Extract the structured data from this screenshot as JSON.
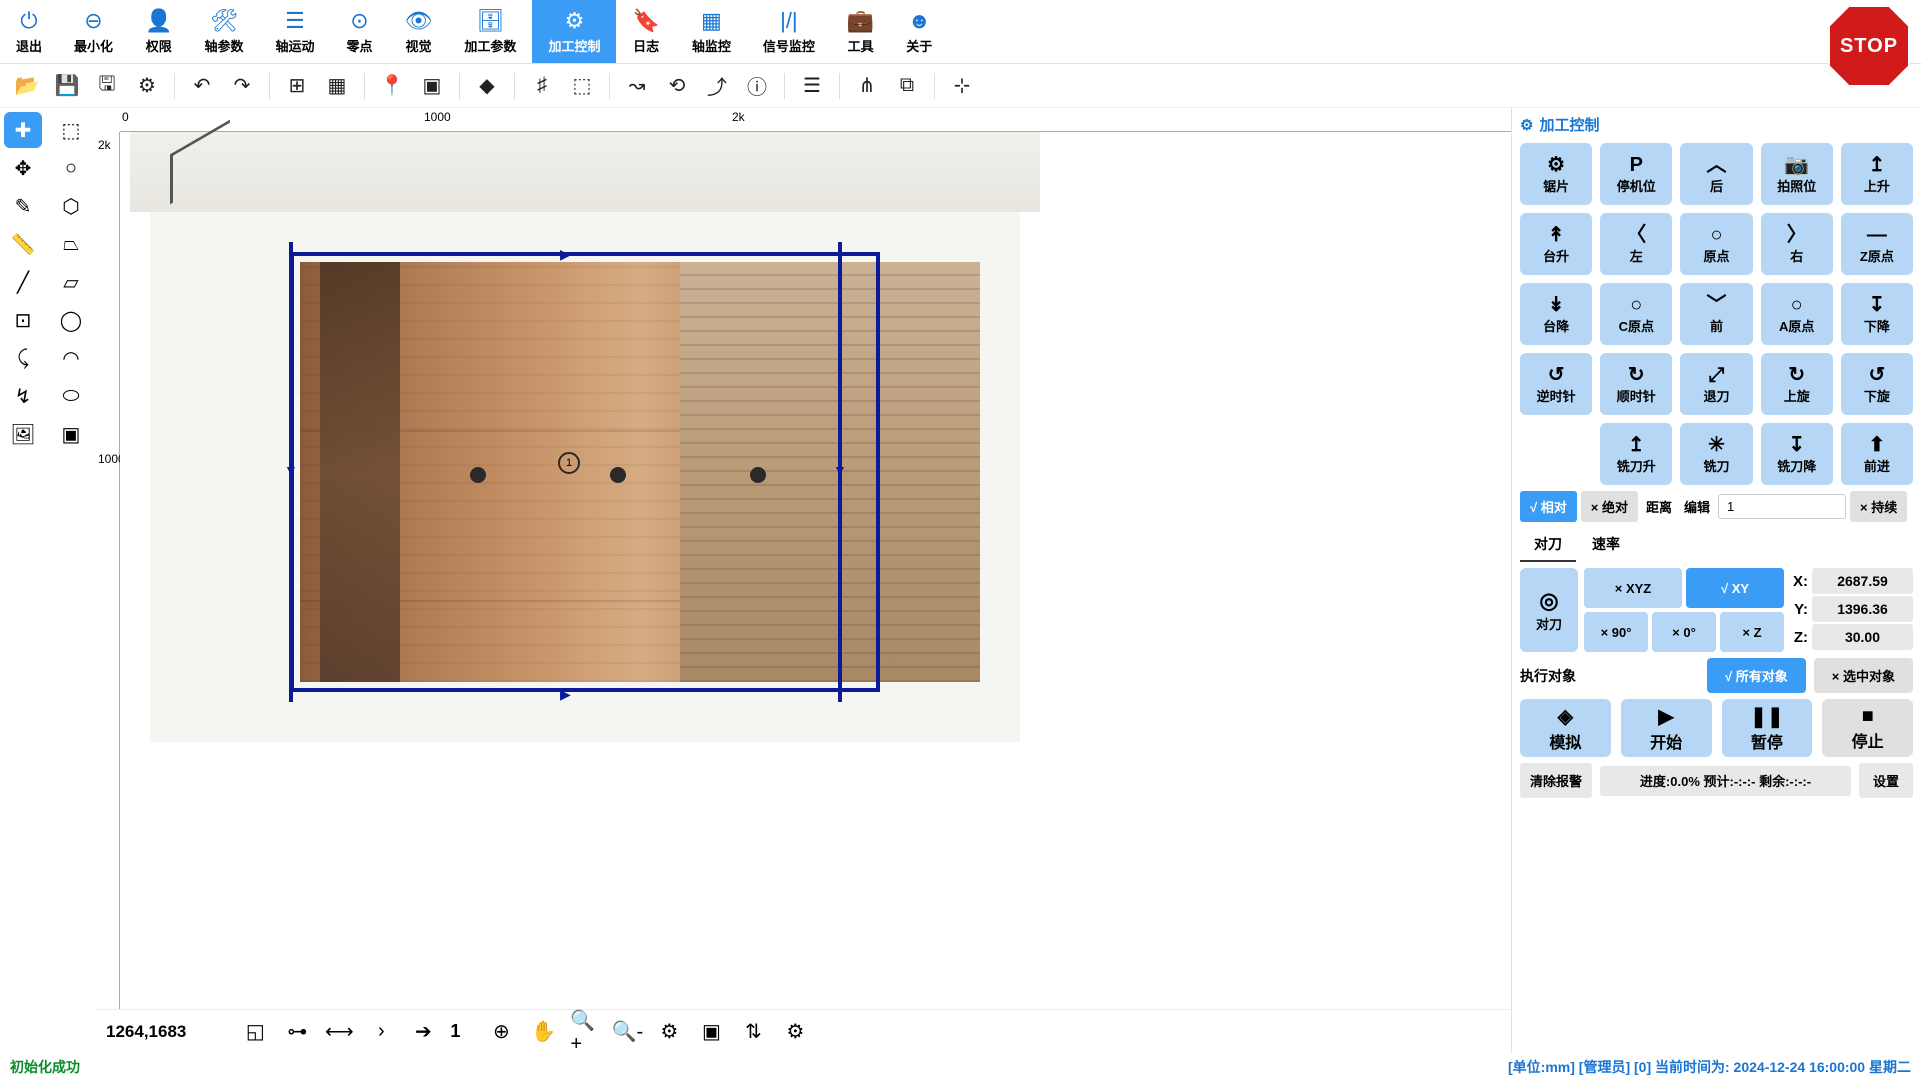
{
  "menu": {
    "items": [
      {
        "icon": "⏻",
        "label": "退出"
      },
      {
        "icon": "⊖",
        "label": "最小化"
      },
      {
        "icon": "👤",
        "label": "权限"
      },
      {
        "icon": "🛠",
        "label": "轴参数"
      },
      {
        "icon": "☰",
        "label": "轴运动"
      },
      {
        "icon": "⊙",
        "label": "零点"
      },
      {
        "icon": "👁",
        "label": "视觉"
      },
      {
        "icon": "🗄",
        "label": "加工参数"
      },
      {
        "icon": "⚙",
        "label": "加工控制",
        "active": true
      },
      {
        "icon": "🔖",
        "label": "日志"
      },
      {
        "icon": "▦",
        "label": "轴监控"
      },
      {
        "icon": "|/|",
        "label": "信号监控"
      },
      {
        "icon": "💼",
        "label": "工具"
      },
      {
        "icon": "☻",
        "label": "关于"
      }
    ]
  },
  "toolbar_icons": [
    "folder",
    "save",
    "save-device",
    "gear",
    "sep",
    "undo",
    "redo",
    "sep",
    "snap",
    "grid",
    "sep",
    "pin",
    "frame",
    "sep",
    "shape",
    "sep",
    "hash",
    "dashsq",
    "sep",
    "path1",
    "path2",
    "path3",
    "info",
    "sep",
    "list",
    "sep",
    "route",
    "layers",
    "sep",
    "align"
  ],
  "left_tools": [
    "✚",
    "⬚",
    "✥",
    "○",
    "✎",
    "⬡",
    "📏",
    "⏢",
    "╱",
    "▱",
    "⊡",
    "◯",
    "⤹",
    "◠",
    "↯",
    "⬭",
    "🖼",
    "▣"
  ],
  "ruler": {
    "h": [
      {
        "pos": "2px",
        "label": "0"
      },
      {
        "pos": "304px",
        "label": "1000"
      },
      {
        "pos": "612px",
        "label": "2k"
      }
    ],
    "v": [
      {
        "pos": "6px",
        "label": "2k"
      },
      {
        "pos": "320px",
        "label": "1000"
      }
    ]
  },
  "right": {
    "title": "加工控制",
    "grid": [
      [
        {
          "icon": "⚙",
          "label": "锯片"
        },
        {
          "icon": "P",
          "label": "停机位"
        },
        {
          "icon": "︿",
          "label": "后"
        },
        {
          "icon": "📷",
          "label": "拍照位"
        },
        {
          "icon": "↥",
          "label": "上升"
        }
      ],
      [
        {
          "icon": "↟",
          "label": "台升"
        },
        {
          "icon": "〈",
          "label": "左"
        },
        {
          "icon": "○",
          "label": "原点"
        },
        {
          "icon": "〉",
          "label": "右"
        },
        {
          "icon": "—",
          "label": "Z原点"
        }
      ],
      [
        {
          "icon": "↡",
          "label": "台降"
        },
        {
          "icon": "○",
          "label": "C原点"
        },
        {
          "icon": "﹀",
          "label": "前"
        },
        {
          "icon": "○",
          "label": "A原点"
        },
        {
          "icon": "↧",
          "label": "下降"
        }
      ],
      [
        {
          "icon": "↺",
          "label": "逆时针"
        },
        {
          "icon": "↻",
          "label": "顺时针"
        },
        {
          "icon": "⤢",
          "label": "退刀"
        },
        {
          "icon": "↻",
          "label": "上旋"
        },
        {
          "icon": "↺",
          "label": "下旋"
        }
      ],
      [
        {
          "icon": "",
          "label": "",
          "empty": true
        },
        {
          "icon": "↥",
          "label": "铣刀升"
        },
        {
          "icon": "✳",
          "label": "铣刀"
        },
        {
          "icon": "↧",
          "label": "铣刀降"
        },
        {
          "icon": "⬆",
          "label": "前进"
        }
      ]
    ],
    "mode": {
      "rel": "√ 相对",
      "abs": "× 绝对",
      "dist_label": "距离",
      "edit_label": "编辑",
      "dist_value": "1",
      "cont": "× 持续"
    },
    "tabs": [
      "对刀",
      "速率"
    ],
    "active_tab": 0,
    "tool_btn": "对刀",
    "xyz_buttons": [
      "× XYZ",
      "√ XY"
    ],
    "angle_buttons": [
      "× 90°",
      "× 0°",
      "× Z"
    ],
    "coords": [
      {
        "axis": "X",
        "val": "2687.59"
      },
      {
        "axis": "Y",
        "val": "1396.36"
      },
      {
        "axis": "Z",
        "val": "30.00"
      }
    ],
    "exec_label": "执行对象",
    "exec_all": "√ 所有对象",
    "exec_sel": "× 选中对象",
    "actions": [
      {
        "icon": "◈",
        "label": "模拟"
      },
      {
        "icon": "▶",
        "label": "开始"
      },
      {
        "icon": "❚❚",
        "label": "暂停"
      },
      {
        "icon": "■",
        "label": "停止",
        "stop": true
      }
    ],
    "clear": "清除报警",
    "progress": "进度:0.0% 预计:-:-:- 剩余:-:-:-",
    "settings": "设置"
  },
  "bottom": {
    "coords": "1264,1683",
    "value": "1"
  },
  "status": {
    "left": "初始化成功",
    "right": "[单位:mm] [管理员] [0] 当前时间为: 2024-12-24 16:00:00 星期二"
  },
  "stop": "STOP"
}
